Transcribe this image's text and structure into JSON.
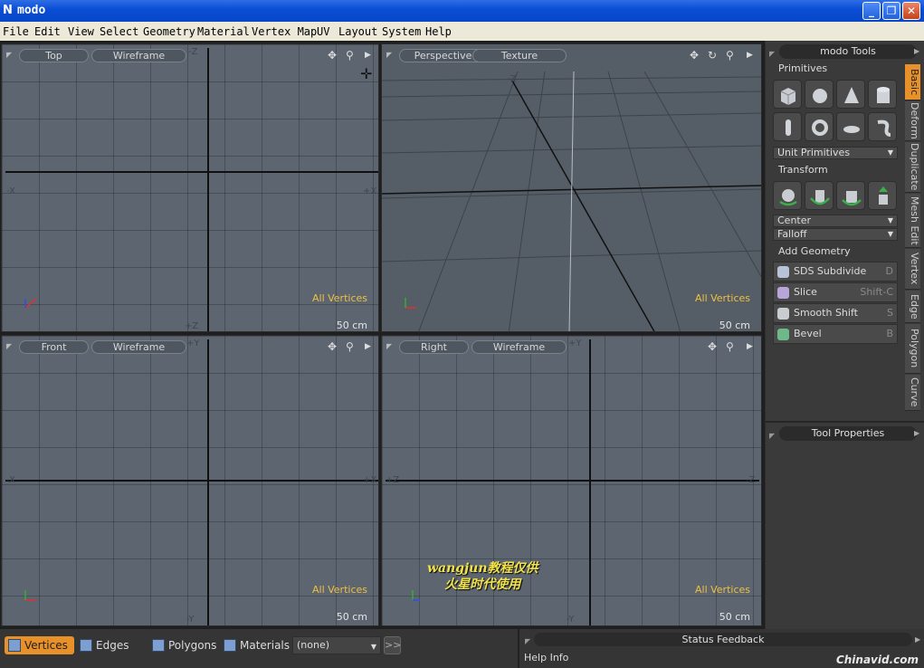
{
  "window": {
    "title": "modo",
    "app_icon": "N"
  },
  "menu": [
    "File",
    "Edit",
    "View",
    "Select",
    "Geometry",
    "Material",
    "Vertex Map",
    "UV",
    "Layout",
    "System",
    "Help"
  ],
  "viewports": {
    "top": {
      "view": "Top",
      "shading": "Wireframe",
      "axis_top": "-Z",
      "axis_left": "-X",
      "axis_right": "+X",
      "axis_bottom": "+Z",
      "selection_mode": "All Vertices",
      "scale": "50 cm"
    },
    "perspective": {
      "view": "Perspective",
      "shading": "Texture",
      "axis_top": "-Z",
      "selection_mode": "All Vertices",
      "scale": "50 cm"
    },
    "front": {
      "view": "Front",
      "shading": "Wireframe",
      "axis_top": "+Y",
      "axis_left": "-X",
      "axis_right": "+X",
      "axis_bottom": "-Y",
      "selection_mode": "All Vertices",
      "scale": "50 cm"
    },
    "right": {
      "view": "Right",
      "shading": "Wireframe",
      "axis_top": "+Y",
      "axis_left": "+Z",
      "axis_right": "-Z",
      "axis_bottom": "-Y",
      "selection_mode": "All Vertices",
      "scale": "50 cm"
    }
  },
  "tools": {
    "title": "modo Tools",
    "primitives_label": "Primitives",
    "primitive_icons": [
      "cube-icon",
      "sphere-icon",
      "cone-icon",
      "cylinder-icon",
      "capsule-icon",
      "torus-icon",
      "ellipsoid-icon",
      "tube-icon"
    ],
    "unit_primitives": "Unit Primitives",
    "transform_label": "Transform",
    "transform_icons": [
      "move-icon",
      "rotate-icon",
      "scale-icon",
      "stretch-icon"
    ],
    "center": "Center",
    "falloff": "Falloff",
    "add_geometry_label": "Add Geometry",
    "add_geometry": [
      {
        "label": "SDS Subdivide",
        "key": "D",
        "icon": "subdivide-icon"
      },
      {
        "label": "Slice",
        "key": "Shift-C",
        "icon": "slice-icon"
      },
      {
        "label": "Smooth Shift",
        "key": "S",
        "icon": "smooth-shift-icon"
      },
      {
        "label": "Bevel",
        "key": "B",
        "icon": "bevel-icon"
      }
    ],
    "tabs": [
      "Basic",
      "Deform",
      "Duplicate",
      "Mesh Edit",
      "Vertex",
      "Edge",
      "Polygon",
      "Curve"
    ],
    "tool_properties": "Tool Properties"
  },
  "bottom": {
    "modes": [
      "Vertices",
      "Edges",
      "Polygons",
      "Materials"
    ],
    "active_mode": "Vertices",
    "material_select": "(none)",
    "expand": ">>",
    "status_feedback": "Status Feedback",
    "help_info": "Help Info",
    "chinavid": "Chinavid.com"
  },
  "watermark": {
    "line1": "wangjun教程仅供",
    "line2": "火星时代使用"
  },
  "colors": {
    "accent": "#e8902a",
    "viewport_bg": "#5c6570",
    "selection_text": "#f0c040",
    "titlebar": "#0a4fd6"
  }
}
